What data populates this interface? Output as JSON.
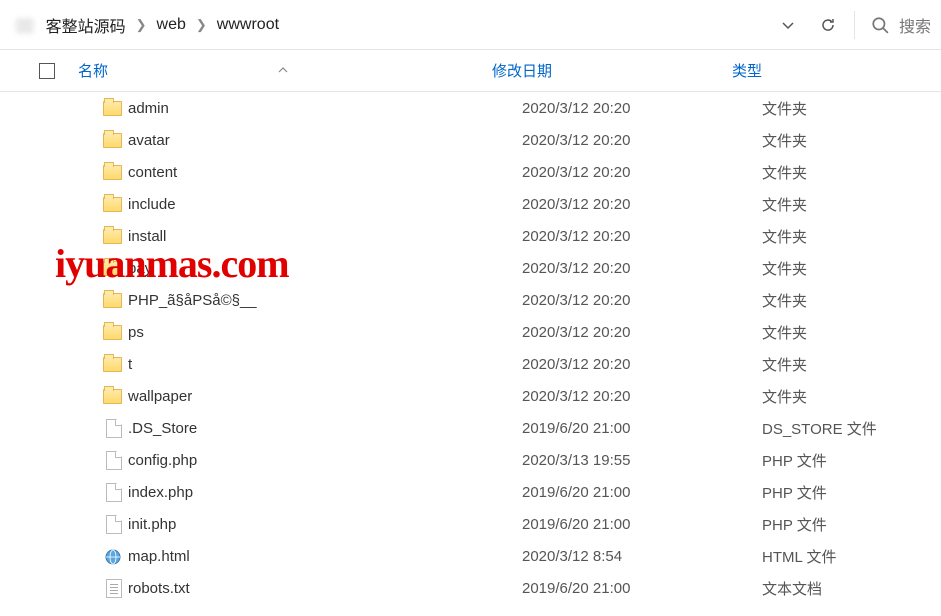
{
  "breadcrumb": {
    "blur_prefix": "▯▯",
    "parts": [
      "客整站源码",
      "web",
      "wwwroot"
    ]
  },
  "search": {
    "label": "搜索"
  },
  "columns": {
    "name": "名称",
    "date": "修改日期",
    "type": "类型"
  },
  "files": [
    {
      "icon": "folder",
      "name": "admin",
      "date": "2020/3/12 20:20",
      "type": "文件夹"
    },
    {
      "icon": "folder",
      "name": "avatar",
      "date": "2020/3/12 20:20",
      "type": "文件夹"
    },
    {
      "icon": "folder",
      "name": "content",
      "date": "2020/3/12 20:20",
      "type": "文件夹"
    },
    {
      "icon": "folder",
      "name": "include",
      "date": "2020/3/12 20:20",
      "type": "文件夹"
    },
    {
      "icon": "folder",
      "name": "install",
      "date": "2020/3/12 20:20",
      "type": "文件夹"
    },
    {
      "icon": "folder",
      "name": "pay",
      "date": "2020/3/12 20:20",
      "type": "文件夹"
    },
    {
      "icon": "folder",
      "name": "PHP_ã§åPSå©§__",
      "date": "2020/3/12 20:20",
      "type": "文件夹"
    },
    {
      "icon": "folder",
      "name": "ps",
      "date": "2020/3/12 20:20",
      "type": "文件夹"
    },
    {
      "icon": "folder",
      "name": "t",
      "date": "2020/3/12 20:20",
      "type": "文件夹"
    },
    {
      "icon": "folder",
      "name": "wallpaper",
      "date": "2020/3/12 20:20",
      "type": "文件夹"
    },
    {
      "icon": "file",
      "name": ".DS_Store",
      "date": "2019/6/20 21:00",
      "type": "DS_STORE 文件"
    },
    {
      "icon": "file",
      "name": "config.php",
      "date": "2020/3/13 19:55",
      "type": "PHP 文件"
    },
    {
      "icon": "file",
      "name": "index.php",
      "date": "2019/6/20 21:00",
      "type": "PHP 文件"
    },
    {
      "icon": "file",
      "name": "init.php",
      "date": "2019/6/20 21:00",
      "type": "PHP 文件"
    },
    {
      "icon": "html",
      "name": "map.html",
      "date": "2020/3/12 8:54",
      "type": "HTML 文件"
    },
    {
      "icon": "txt",
      "name": "robots.txt",
      "date": "2019/6/20 21:00",
      "type": "文本文档"
    }
  ],
  "watermark": "iyuanmas.com"
}
